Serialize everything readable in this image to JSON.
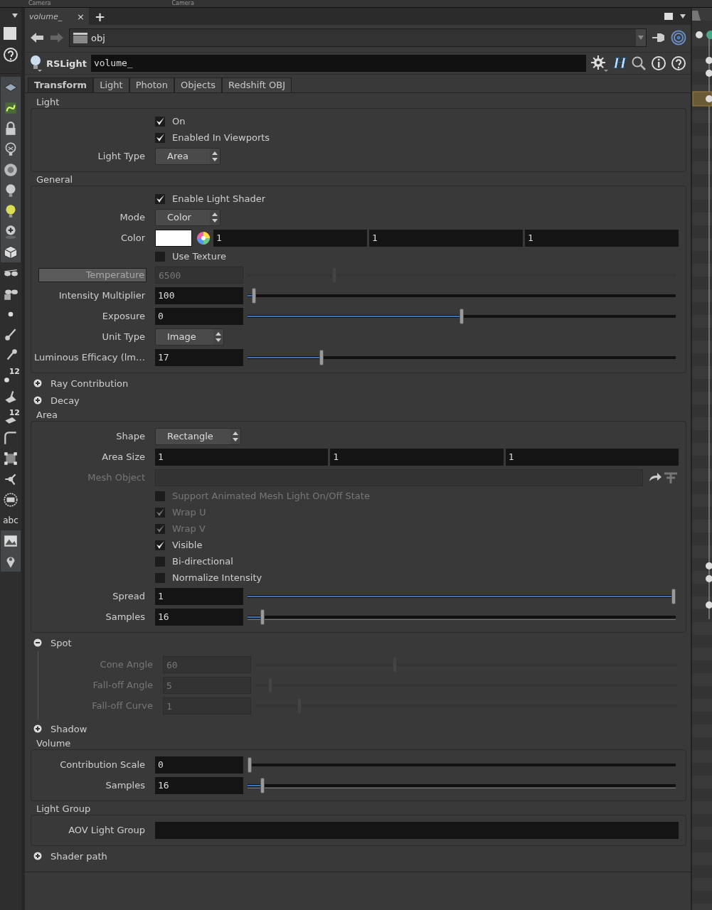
{
  "top_strip": [
    "Camera",
    "Camera"
  ],
  "toolbar_labels": [
    "12",
    "12",
    "abc"
  ],
  "pane_tab": {
    "label": "volume_",
    "close": "×",
    "add": "+"
  },
  "path": "obj",
  "node": {
    "type": "RSLight",
    "name": "volume_",
    "help_glyph": "H"
  },
  "tabs": [
    {
      "label": "Transform",
      "selected": true
    },
    {
      "label": "Light",
      "selected": false
    },
    {
      "label": "Photon",
      "selected": false
    },
    {
      "label": "Objects",
      "selected": false
    },
    {
      "label": "Redshift OBJ",
      "selected": false
    }
  ],
  "sections": [
    {
      "title": "Light",
      "kind": "group",
      "rows": [
        {
          "kind": "checkbox",
          "label": "On",
          "checked": true,
          "disabled": false
        },
        {
          "kind": "checkbox",
          "label": "Enabled In Viewports",
          "checked": true,
          "disabled": false
        },
        {
          "kind": "menu",
          "label": "Light Type",
          "value": "Area"
        }
      ]
    },
    {
      "title": "General",
      "kind": "group",
      "rows": [
        {
          "kind": "checkbox",
          "label": "Enable Light Shader",
          "checked": true,
          "disabled": false
        },
        {
          "kind": "menu",
          "label": "Mode",
          "value": "Color"
        },
        {
          "kind": "color",
          "label": "Color",
          "color": "#ffffff",
          "values": [
            "1",
            "1",
            "1"
          ]
        },
        {
          "kind": "checkbox",
          "label": "Use Texture",
          "checked": false,
          "disabled": false
        },
        {
          "kind": "slider",
          "label": "Temperature",
          "boxed": true,
          "value": "6500",
          "level": 0.2,
          "disabled": true,
          "ticks": false
        },
        {
          "kind": "slider",
          "label": "Intensity Multiplier",
          "value": "100",
          "level": 0.01,
          "disabled": false,
          "ticks": false
        },
        {
          "kind": "slider",
          "label": "Exposure",
          "value": "0",
          "level": 0.5,
          "disabled": false,
          "ticks": false
        },
        {
          "kind": "menu",
          "label": "Unit Type",
          "value": "Image"
        },
        {
          "kind": "slider",
          "label": "Luminous Efficacy (lm…",
          "value": "17",
          "level": 0.17,
          "disabled": false,
          "ticks": false
        }
      ]
    },
    {
      "title": "Ray Contribution",
      "kind": "folder",
      "expanded": false
    },
    {
      "title": "Decay",
      "kind": "folder",
      "expanded": false
    },
    {
      "title": "Area",
      "kind": "group",
      "rows": [
        {
          "kind": "menu",
          "label": "Shape",
          "value": "Rectangle"
        },
        {
          "kind": "vector",
          "label": "Area Size",
          "values": [
            "1",
            "1",
            "1"
          ]
        },
        {
          "kind": "path",
          "label": "Mesh Object",
          "disabled": true
        },
        {
          "kind": "checkbox",
          "label": "Support Animated Mesh Light On/Off State",
          "checked": false,
          "disabled": true
        },
        {
          "kind": "checkbox",
          "label": "Wrap U",
          "checked": true,
          "disabled": true
        },
        {
          "kind": "checkbox",
          "label": "Wrap V",
          "checked": true,
          "disabled": true
        },
        {
          "kind": "checkbox",
          "label": "Visible",
          "checked": true,
          "disabled": false
        },
        {
          "kind": "checkbox",
          "label": "Bi-directional",
          "checked": false,
          "disabled": false
        },
        {
          "kind": "checkbox",
          "label": "Normalize Intensity",
          "checked": false,
          "disabled": false
        },
        {
          "kind": "slider",
          "label": "Spread",
          "value": "1",
          "level": 1,
          "disabled": false,
          "ticks": false
        },
        {
          "kind": "slider",
          "label": "Samples",
          "value": "16",
          "level": 0.03,
          "disabled": false,
          "ticks": true
        }
      ]
    },
    {
      "title": "Spot",
      "kind": "folder",
      "expanded": true,
      "rows": [
        {
          "kind": "slider",
          "label": "Cone Angle",
          "value": "60",
          "level": 0.33,
          "disabled": true,
          "ticks": false
        },
        {
          "kind": "slider",
          "label": "Fall-off Angle",
          "value": "5",
          "level": 0.03,
          "disabled": true,
          "ticks": false
        },
        {
          "kind": "slider",
          "label": "Fall-off Curve",
          "value": "1",
          "level": 0.1,
          "disabled": true,
          "ticks": false
        }
      ]
    },
    {
      "title": "Shadow",
      "kind": "folder",
      "expanded": false
    },
    {
      "title": "Volume",
      "kind": "group",
      "rows": [
        {
          "kind": "slider",
          "label": "Contribution Scale",
          "value": "0",
          "level": 0,
          "disabled": false,
          "ticks": false
        },
        {
          "kind": "slider",
          "label": "Samples",
          "value": "16",
          "level": 0.03,
          "disabled": false,
          "ticks": true
        }
      ]
    },
    {
      "title": "Light Group",
      "kind": "group",
      "rows": [
        {
          "kind": "text",
          "label": "AOV Light Group"
        }
      ]
    },
    {
      "title": "Shader path",
      "kind": "folder",
      "expanded": false
    }
  ]
}
